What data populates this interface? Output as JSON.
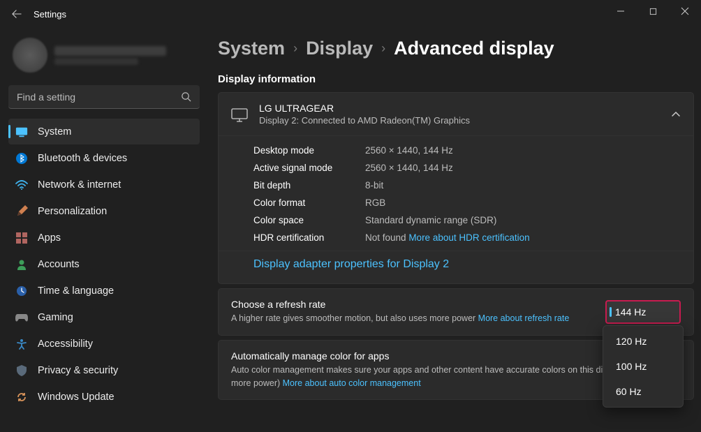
{
  "titlebar": {
    "title": "Settings"
  },
  "search": {
    "placeholder": "Find a setting"
  },
  "nav": [
    {
      "icon": "system",
      "label": "System",
      "active": true
    },
    {
      "icon": "bluetooth",
      "label": "Bluetooth & devices"
    },
    {
      "icon": "network",
      "label": "Network & internet"
    },
    {
      "icon": "personalization",
      "label": "Personalization"
    },
    {
      "icon": "apps",
      "label": "Apps"
    },
    {
      "icon": "accounts",
      "label": "Accounts"
    },
    {
      "icon": "time",
      "label": "Time & language"
    },
    {
      "icon": "gaming",
      "label": "Gaming"
    },
    {
      "icon": "accessibility",
      "label": "Accessibility"
    },
    {
      "icon": "privacy",
      "label": "Privacy & security"
    },
    {
      "icon": "update",
      "label": "Windows Update"
    }
  ],
  "breadcrumb": {
    "a": "System",
    "b": "Display",
    "c": "Advanced display"
  },
  "section": {
    "title": "Display information"
  },
  "display": {
    "name": "LG ULTRAGEAR",
    "sub": "Display 2: Connected to AMD Radeon(TM) Graphics",
    "rows": {
      "desktop_mode": {
        "k": "Desktop mode",
        "v": "2560 × 1440, 144 Hz"
      },
      "active_signal": {
        "k": "Active signal mode",
        "v": "2560 × 1440, 144 Hz"
      },
      "bit_depth": {
        "k": "Bit depth",
        "v": "8-bit"
      },
      "color_format": {
        "k": "Color format",
        "v": "RGB"
      },
      "color_space": {
        "k": "Color space",
        "v": "Standard dynamic range (SDR)"
      },
      "hdr": {
        "k": "HDR certification",
        "v": "Not found",
        "link": "More about HDR certification"
      }
    },
    "adapter_link": "Display adapter properties for Display 2"
  },
  "refresh": {
    "title": "Choose a refresh rate",
    "desc": "A higher rate gives smoother motion, but also uses more power  ",
    "link": "More about refresh rate",
    "selected": "144 Hz",
    "options": [
      "120 Hz",
      "100 Hz",
      "60 Hz"
    ]
  },
  "color": {
    "title": "Automatically manage color for apps",
    "desc": "Auto color management makes sure your apps and other content have accurate colors on this display (this may use more power) ",
    "link": "More about auto color management"
  }
}
